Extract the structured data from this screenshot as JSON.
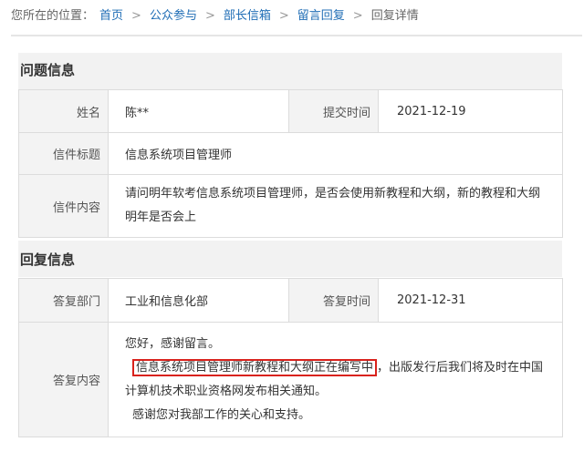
{
  "breadcrumb": {
    "prefix": "您所在的位置：",
    "items": [
      "首页",
      "公众参与",
      "部长信箱",
      "留言回复"
    ],
    "current": "回复详情",
    "separator": ">"
  },
  "question": {
    "section_title": "问题信息",
    "name_label": "姓名",
    "name_value": "陈**",
    "submit_time_label": "提交时间",
    "submit_time_value": "2021-12-19",
    "subject_label": "信件标题",
    "subject_value": "信息系统项目管理师",
    "content_label": "信件内容",
    "content_value": "请问明年软考信息系统项目管理师，是否会使用新教程和大纲，新的教程和大纲明年是否会上"
  },
  "reply": {
    "section_title": "回复信息",
    "dept_label": "答复部门",
    "dept_value": "工业和信息化部",
    "time_label": "答复时间",
    "time_value": "2021-12-31",
    "content_label": "答复内容",
    "greeting": "您好，感谢留言。",
    "highlight_text": "信息系统项目管理师新教程和大纲正在编写中",
    "after_highlight": "，出版发行后我们将及时在中国计算机技术职业资格网发布相关通知。",
    "closing": "感谢您对我部工作的关心和支持。"
  },
  "colors": {
    "link": "#1f6db5",
    "highlight_border": "#d9221c",
    "label_bg": "#f3f3f3",
    "border": "#dcdcdc"
  }
}
